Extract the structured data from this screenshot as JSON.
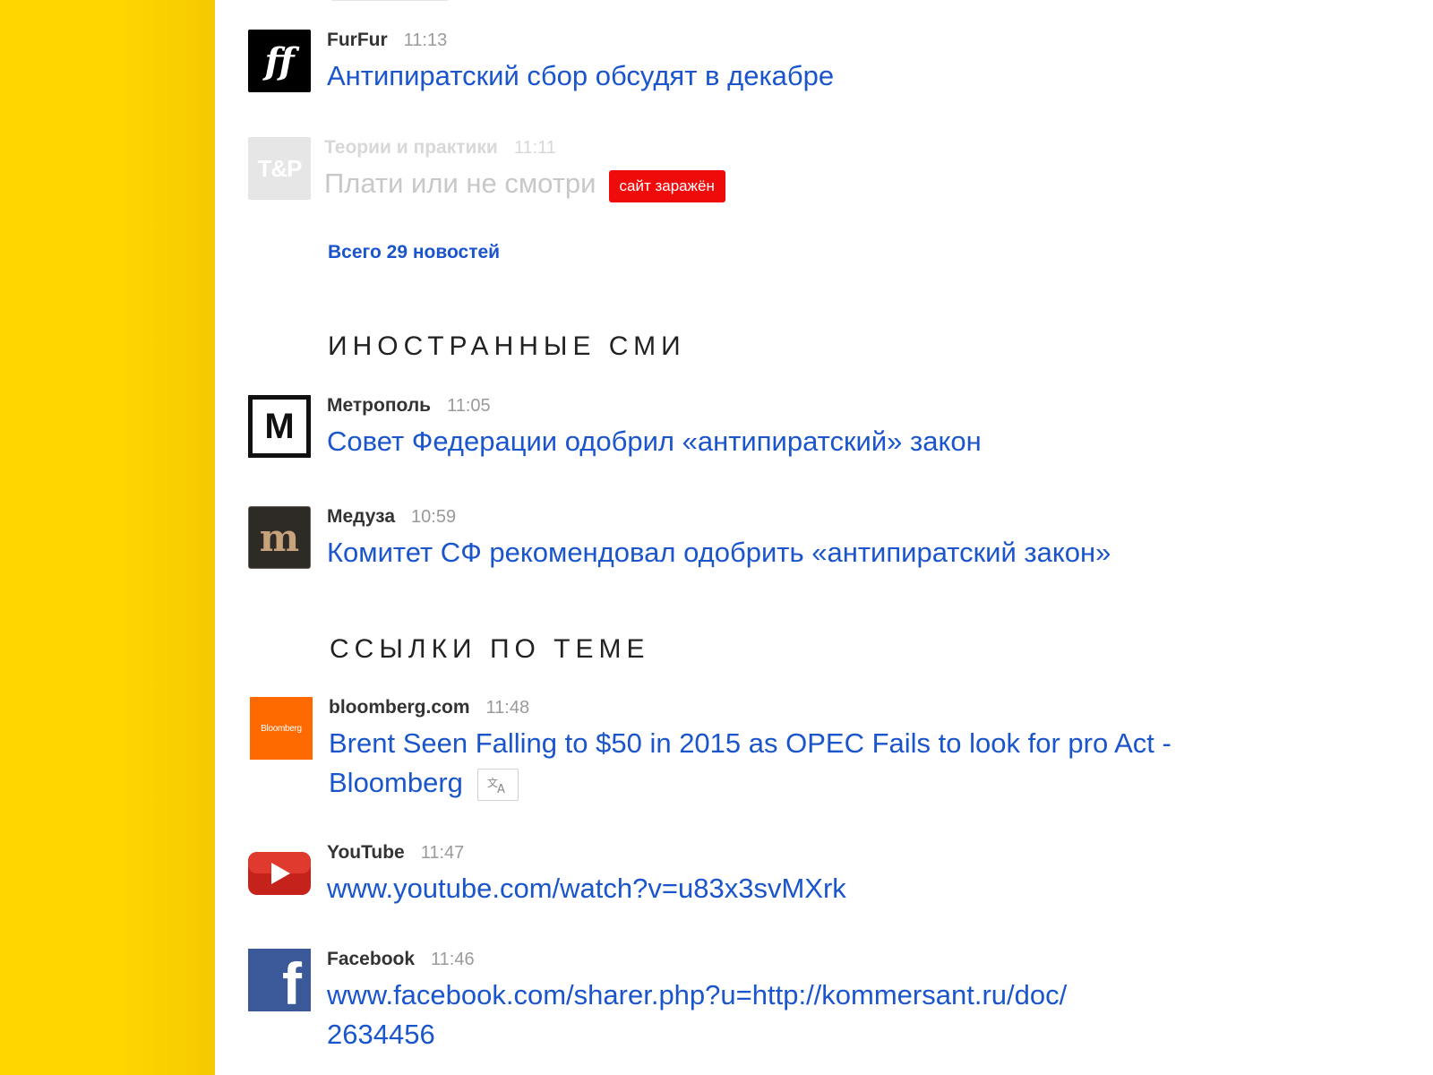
{
  "news": [
    {
      "source": "FurFur",
      "time": "11:13",
      "headline": "Антипиратский сбор обсудят в декабре",
      "logo_icon": "furfur-logo-icon",
      "logo_text": "ff"
    },
    {
      "source": "Теории и практики",
      "time": "11:11",
      "headline": "Плати или не смотри",
      "badge": "сайт заражён",
      "logo_icon": "tp-logo-icon",
      "logo_text": "T&P"
    }
  ],
  "all_news_link": "Всего 29 новостей",
  "foreign_section": {
    "title": "ИНОСТРАННЫЕ СМИ",
    "items": [
      {
        "source": "Метрополь",
        "time": "11:05",
        "headline": "Совет Федерации одобрил «антипиратский» закон",
        "logo_icon": "metropol-logo-icon",
        "logo_text": "M"
      },
      {
        "source": "Медуза",
        "time": "10:59",
        "headline": "Комитет СФ рекомендовал одобрить «антипиратский закон»",
        "logo_icon": "meduza-logo-icon",
        "logo_text": "m"
      }
    ]
  },
  "links_section": {
    "title": "ССЫЛКИ ПО ТЕМЕ",
    "items": [
      {
        "source": "bloomberg.com",
        "time": "11:48",
        "headline_line1": "Brent Seen Falling to $50 in 2015 as OPEC Fails to look for pro Act -",
        "headline_line2": "Bloomberg",
        "logo_icon": "bloomberg-logo-icon",
        "logo_text": "Bloomberg",
        "translate_icon": "translate-icon"
      },
      {
        "source": "YouTube",
        "time": "11:47",
        "headline": "www.youtube.com/watch?v=u83x3svMXrk",
        "logo_icon": "youtube-logo-icon"
      },
      {
        "source": "Facebook",
        "time": "11:46",
        "headline_line1": "www.facebook.com/sharer.php?u=http://kommersant.ru/doc/",
        "headline_line2": "2634456",
        "logo_icon": "facebook-logo-icon",
        "logo_text": "f"
      }
    ]
  },
  "colors": {
    "sidebar": "#ffd600",
    "link": "#1a55cc",
    "badge": "#f00b0b",
    "bloomberg": "#ff6a00",
    "youtube": "#d52b1e",
    "facebook": "#3b5998",
    "meduza": "#2e2a26"
  }
}
